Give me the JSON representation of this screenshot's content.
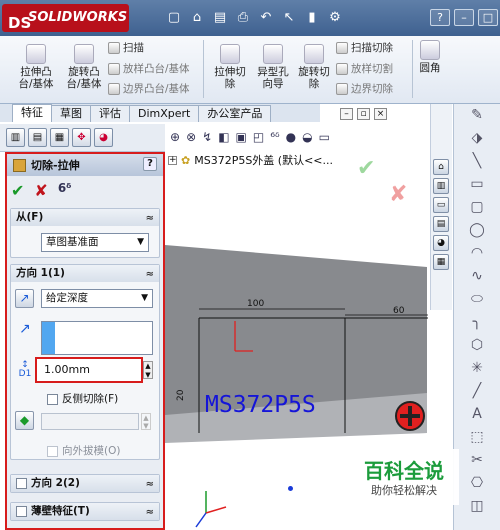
{
  "app": {
    "name": "SOLIDWORKS",
    "logo_mark": "DS"
  },
  "window_buttons": [
    "?",
    "–",
    "□",
    "×"
  ],
  "ribbon": {
    "big_buttons": [
      {
        "label": "拉伸凸台/基体",
        "line1": "拉伸凸",
        "line2": "台/基体"
      },
      {
        "label": "旋转凸台/基体",
        "line1": "旋转凸",
        "line2": "台/基体"
      },
      {
        "label": "拉伸切除",
        "line1": "拉伸切",
        "line2": "除"
      },
      {
        "label": "异型孔向导",
        "line1": "异型孔",
        "line2": "向导"
      },
      {
        "label": "旋转切除",
        "line1": "旋转切",
        "line2": "除"
      },
      {
        "label": "圆角",
        "line1": "圆角",
        "line2": ""
      }
    ],
    "small_buttons_1": [
      "扫描",
      "放样凸台/基体",
      "边界凸台/基体"
    ],
    "small_buttons_2": [
      "扫描切除",
      "放样切割",
      "边界切除"
    ]
  },
  "tabs": [
    "特征",
    "草图",
    "评估",
    "DimXpert",
    "办公室产品"
  ],
  "property_manager": {
    "title": "切除-拉伸",
    "help": "?",
    "ok": "✔",
    "cancel": "✘",
    "preview": "6ᵟ",
    "from_group": {
      "title": "从(F)",
      "value": "草图基准面"
    },
    "direction1_group": {
      "title": "方向 1(1)",
      "end_condition": "给定深度",
      "depth": "1.00mm",
      "depth_label": "D1",
      "flip_side_label": "反侧切除(F)",
      "draft_outward_label": "向外拔模(O)"
    },
    "direction2_group": {
      "title": "方向 2(2)"
    },
    "thin_group": {
      "title": "薄壁特征(T)"
    }
  },
  "feature_tree": {
    "node": "MS372P5S外盖 (默认<<..."
  },
  "model": {
    "dim_100": "100",
    "dim_60": "60",
    "dim_20": "20",
    "engraved_text": "MS372P5S"
  },
  "watermark": {
    "title": "百科全说",
    "subtitle": "助你轻松解决"
  },
  "colors": {
    "accent_red": "#d71c1c",
    "text_blue": "#1515d8",
    "ok_green": "#1a9a2a"
  }
}
